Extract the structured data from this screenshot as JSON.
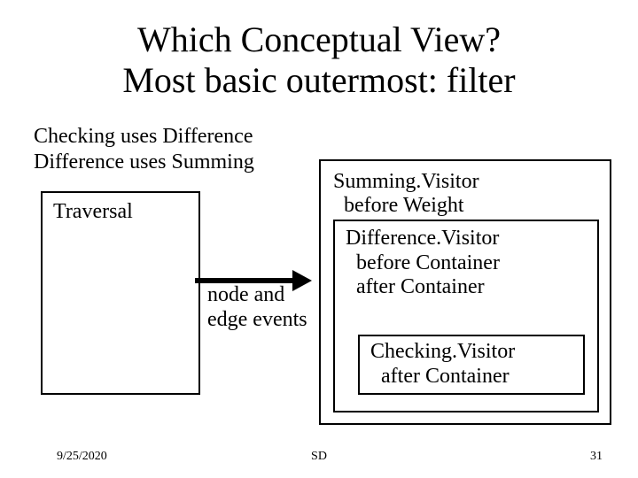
{
  "title_line1": "Which Conceptual View?",
  "title_line2": "Most basic outermost: filter",
  "subtext_line1": "Checking uses Difference",
  "subtext_line2": "Difference uses Summing",
  "traversal_label": "Traversal",
  "arrow_label_line1": "node and",
  "arrow_label_line2": "edge events",
  "summing_line1": "Summing.Visitor",
  "summing_line2": "  before Weight",
  "difference_line1": "Difference.Visitor",
  "difference_line2": "  before Container",
  "difference_line3": "  after Container",
  "checking_line1": "Checking.Visitor",
  "checking_line2": "  after Container",
  "footer": {
    "date": "9/25/2020",
    "center": "SD",
    "page": "31"
  }
}
